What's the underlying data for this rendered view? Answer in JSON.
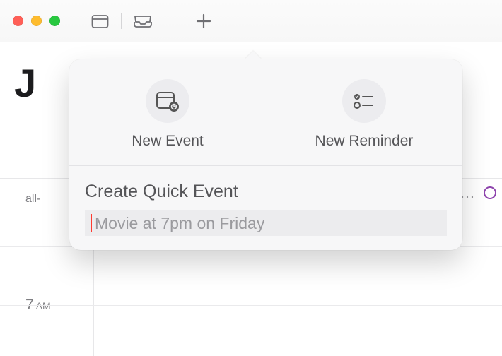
{
  "toolbar": {
    "icons": {
      "calendars": "calendars-icon",
      "inbox": "inbox-icon",
      "add": "plus-icon"
    }
  },
  "header": {
    "month_truncated": "J"
  },
  "calendar": {
    "allday_label": "all-",
    "overflow_glyph": "…",
    "hour_labels": [
      {
        "num": "7",
        "suffix": "AM"
      }
    ]
  },
  "popover": {
    "options": {
      "new_event_label": "New Event",
      "new_reminder_label": "New Reminder"
    },
    "quick": {
      "heading": "Create Quick Event",
      "placeholder": "Movie at 7pm on Friday"
    }
  }
}
